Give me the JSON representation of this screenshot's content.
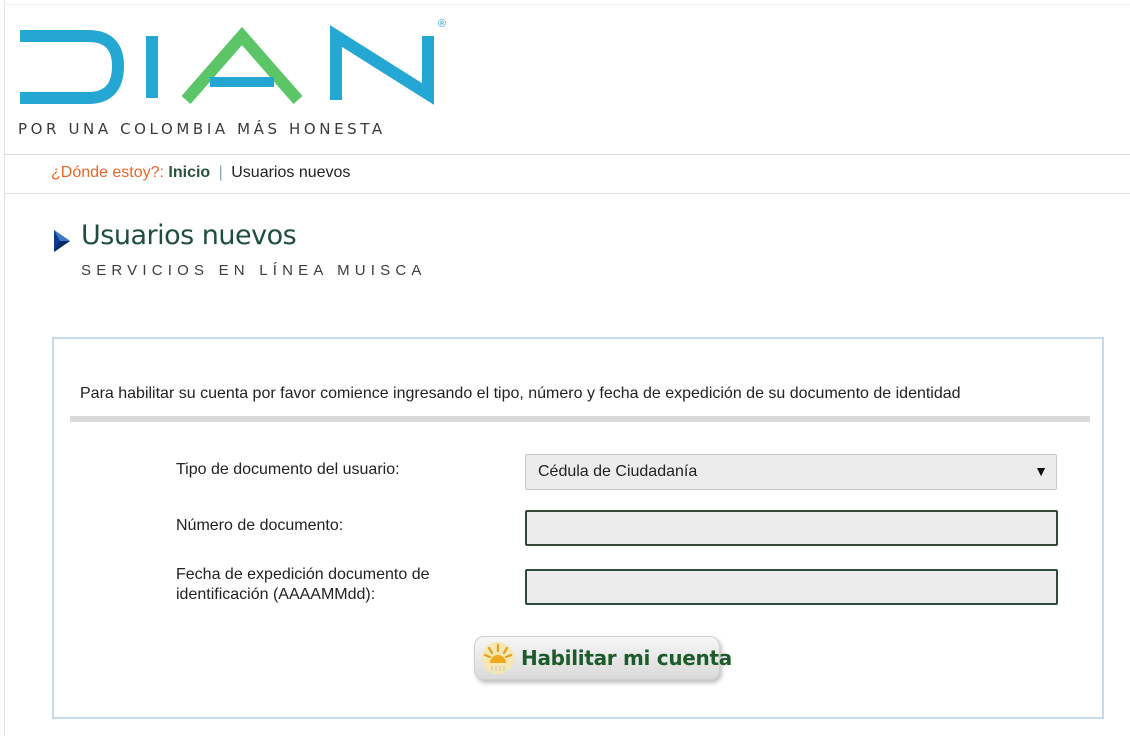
{
  "brand": {
    "logo_text": "DIAN",
    "registered_mark": "®",
    "tagline": "POR UNA COLOMBIA MÁS HONESTA",
    "colors": {
      "blue": "#25a7d4",
      "green": "#5bc568"
    }
  },
  "breadcrumb": {
    "where_label": "¿Dónde estoy?:",
    "home_label": "Inicio",
    "separator": "|",
    "current_label": "Usuarios nuevos"
  },
  "page": {
    "title": "Usuarios nuevos",
    "subtitle": "SERVICIOS EN LÍNEA MUISCA"
  },
  "form": {
    "intro": "Para habilitar su cuenta por favor comience ingresando el tipo, número y fecha de expedición de su documento de identidad",
    "doc_type_label": "Tipo de documento del usuario:",
    "doc_type_value": "Cédula de Ciudadanía",
    "doc_type_caret": "▼",
    "doc_number_label": "Número de documento:",
    "doc_number_value": "",
    "issue_date_label_line1": "Fecha de expedición documento de",
    "issue_date_label_line2": "identificación (AAAAMMdd):",
    "issue_date_value": "",
    "submit_label": "Habilitar mi cuenta"
  },
  "colors": {
    "accent_orange": "#e8662a",
    "title_green": "#1f4e3c",
    "panel_border": "#c7daec",
    "input_border": "#2e4a3b"
  }
}
